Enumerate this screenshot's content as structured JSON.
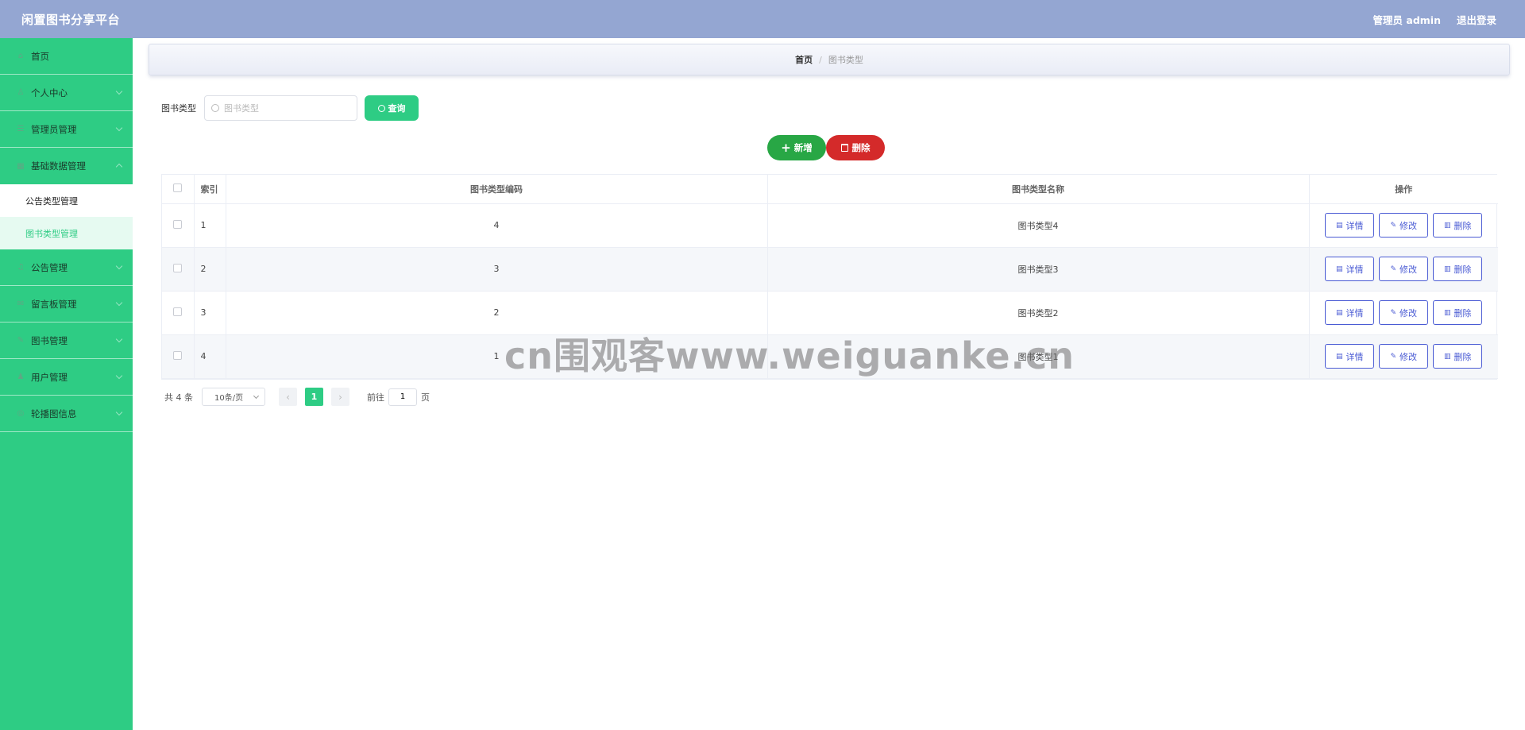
{
  "header": {
    "title": "闲置图书分享平台",
    "user": "管理员 admin",
    "logout": "退出登录"
  },
  "sidebar": {
    "items": [
      {
        "label": "首页",
        "icon": "home-icon"
      },
      {
        "label": "个人中心",
        "icon": "user-icon"
      },
      {
        "label": "管理员管理",
        "icon": "admin-icon"
      },
      {
        "label": "基础数据管理",
        "icon": "data-icon"
      },
      {
        "label": "公告管理",
        "icon": "notice-icon"
      },
      {
        "label": "留言板管理",
        "icon": "message-icon"
      },
      {
        "label": "图书管理",
        "icon": "book-icon"
      },
      {
        "label": "用户管理",
        "icon": "users-icon"
      },
      {
        "label": "轮播图信息",
        "icon": "carousel-icon"
      }
    ],
    "sub_items": [
      {
        "label": "公告类型管理"
      },
      {
        "label": "图书类型管理"
      }
    ]
  },
  "breadcrumb": {
    "home": "首页",
    "separator": "/",
    "current": "图书类型"
  },
  "search": {
    "label": "图书类型",
    "placeholder": "图书类型",
    "button": "查询"
  },
  "actions": {
    "add": "新增",
    "delete": "删除"
  },
  "table": {
    "columns": [
      "索引",
      "图书类型编码",
      "图书类型名称",
      "操作"
    ],
    "rows": [
      {
        "index": "1",
        "code": "4",
        "name": "图书类型4"
      },
      {
        "index": "2",
        "code": "3",
        "name": "图书类型3"
      },
      {
        "index": "3",
        "code": "2",
        "name": "图书类型2"
      },
      {
        "index": "4",
        "code": "1",
        "name": "图书类型1"
      }
    ],
    "row_actions": {
      "detail": "详情",
      "edit": "修改",
      "delete": "删除"
    }
  },
  "pagination": {
    "total": "共 4 条",
    "page_size": "10条/页",
    "current_page": "1",
    "goto_label": "前往",
    "goto_value": "1",
    "page_suffix": "页"
  },
  "watermark": "cn围观客www.weiguanke.cn",
  "colors": {
    "header": "#94a6d2",
    "sidebar": "#2ecc84",
    "add": "#28a745",
    "delete": "#d42a2a",
    "link": "#4a5bd4"
  }
}
